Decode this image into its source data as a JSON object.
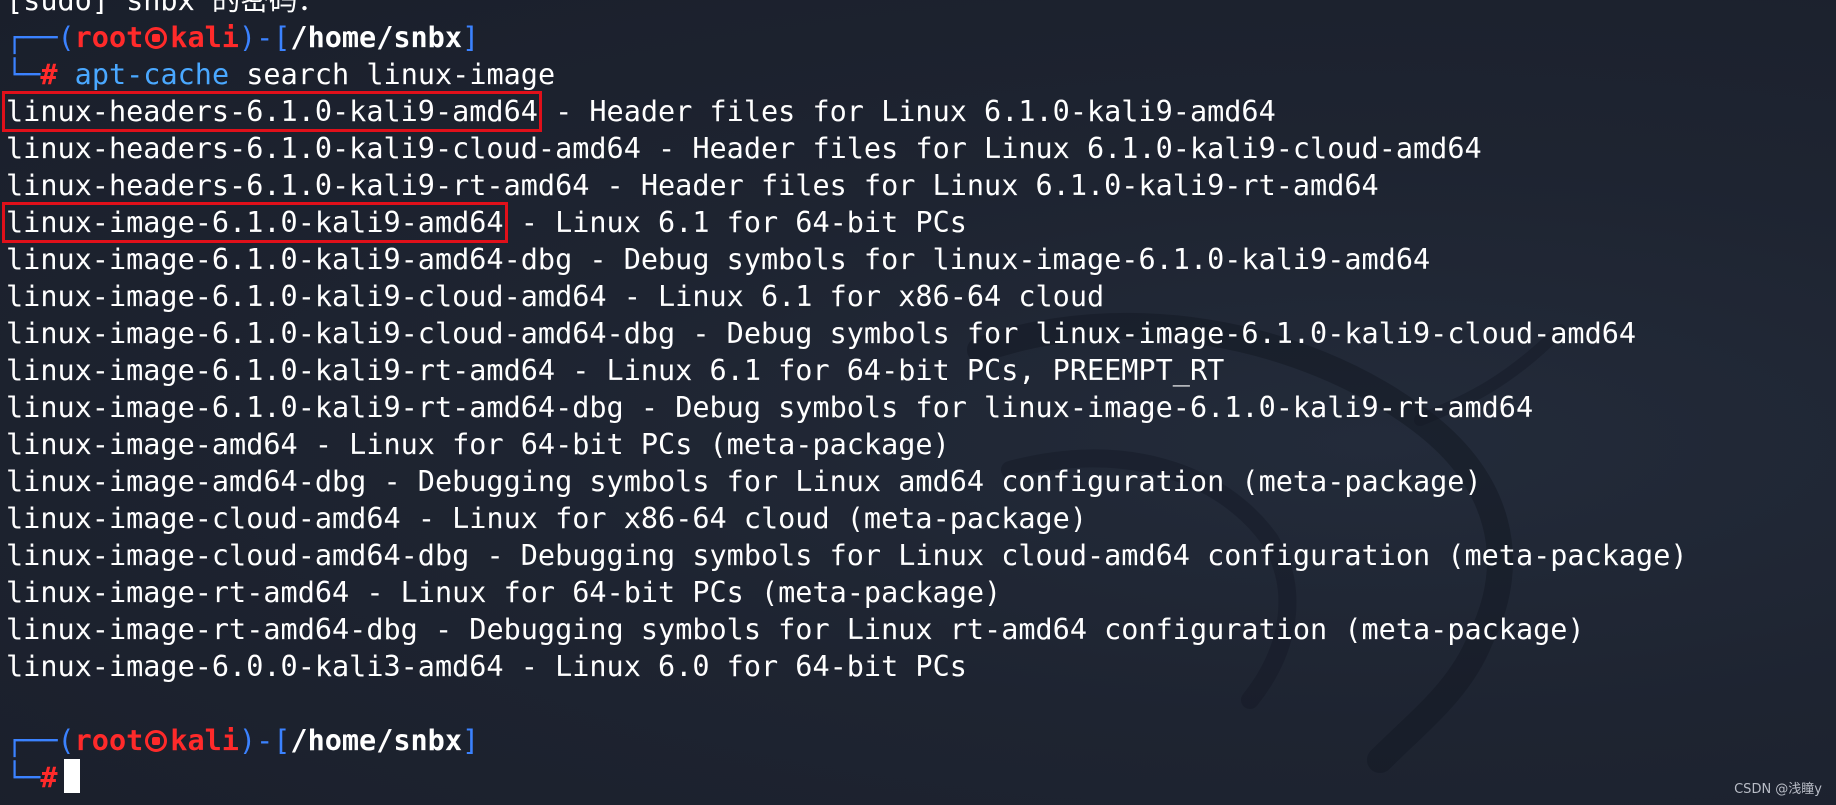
{
  "top_partial": "[sudo] snbx 的密码：",
  "prompt1": {
    "corner_top": "┌──(",
    "user": "root",
    "skull_icon": "kali-skull-icon",
    "host": "kali",
    "mid": ")-[",
    "path": "/home/snbx",
    "end": "]",
    "corner_bottom": "└─",
    "hash": "#",
    "command_name": "apt-cache",
    "command_args": " search linux-image"
  },
  "results": [
    {
      "pkg": "linux-headers-6.1.0-kali9-amd64",
      "desc": " - Header files for Linux 6.1.0-kali9-amd64",
      "highlighted": true
    },
    {
      "pkg": "linux-headers-6.1.0-kali9-cloud-amd64",
      "desc": " - Header files for Linux 6.1.0-kali9-cloud-amd64",
      "highlighted": false
    },
    {
      "pkg": "linux-headers-6.1.0-kali9-rt-amd64",
      "desc": " - Header files for Linux 6.1.0-kali9-rt-amd64",
      "highlighted": false
    },
    {
      "pkg": "linux-image-6.1.0-kali9-amd64",
      "desc": " - Linux 6.1 for 64-bit PCs",
      "highlighted": true
    },
    {
      "pkg": "linux-image-6.1.0-kali9-amd64-dbg",
      "desc": " - Debug symbols for linux-image-6.1.0-kali9-amd64",
      "highlighted": false
    },
    {
      "pkg": "linux-image-6.1.0-kali9-cloud-amd64",
      "desc": " - Linux 6.1 for x86-64 cloud",
      "highlighted": false
    },
    {
      "pkg": "linux-image-6.1.0-kali9-cloud-amd64-dbg",
      "desc": " - Debug symbols for linux-image-6.1.0-kali9-cloud-amd64",
      "highlighted": false
    },
    {
      "pkg": "linux-image-6.1.0-kali9-rt-amd64",
      "desc": " - Linux 6.1 for 64-bit PCs, PREEMPT_RT",
      "highlighted": false
    },
    {
      "pkg": "linux-image-6.1.0-kali9-rt-amd64-dbg",
      "desc": " - Debug symbols for linux-image-6.1.0-kali9-rt-amd64",
      "highlighted": false
    },
    {
      "pkg": "linux-image-amd64",
      "desc": " - Linux for 64-bit PCs (meta-package)",
      "highlighted": false
    },
    {
      "pkg": "linux-image-amd64-dbg",
      "desc": " - Debugging symbols for Linux amd64 configuration (meta-package)",
      "highlighted": false
    },
    {
      "pkg": "linux-image-cloud-amd64",
      "desc": " - Linux for x86-64 cloud (meta-package)",
      "highlighted": false
    },
    {
      "pkg": "linux-image-cloud-amd64-dbg",
      "desc": " - Debugging symbols for Linux cloud-amd64 configuration (meta-package)",
      "highlighted": false
    },
    {
      "pkg": "linux-image-rt-amd64",
      "desc": " - Linux for 64-bit PCs (meta-package)",
      "highlighted": false
    },
    {
      "pkg": "linux-image-rt-amd64-dbg",
      "desc": " - Debugging symbols for Linux rt-amd64 configuration (meta-package)",
      "highlighted": false
    },
    {
      "pkg": "linux-image-6.0.0-kali3-amd64",
      "desc": " - Linux 6.0 for 64-bit PCs",
      "highlighted": false
    }
  ],
  "prompt2": {
    "corner_top": "┌──(",
    "user": "root",
    "skull_icon": "kali-skull-icon",
    "host": "kali",
    "mid": ")-[",
    "path": "/home/snbx",
    "end": "]",
    "corner_bottom": "└─",
    "hash": "#"
  },
  "watermark": "CSDN @浅瞳y",
  "colors": {
    "background": "#1d2330",
    "prompt_frame": "#3b82ff",
    "prompt_user": "#ff2a2a",
    "command": "#4aa8ff",
    "highlight_box": "#e0101a"
  }
}
